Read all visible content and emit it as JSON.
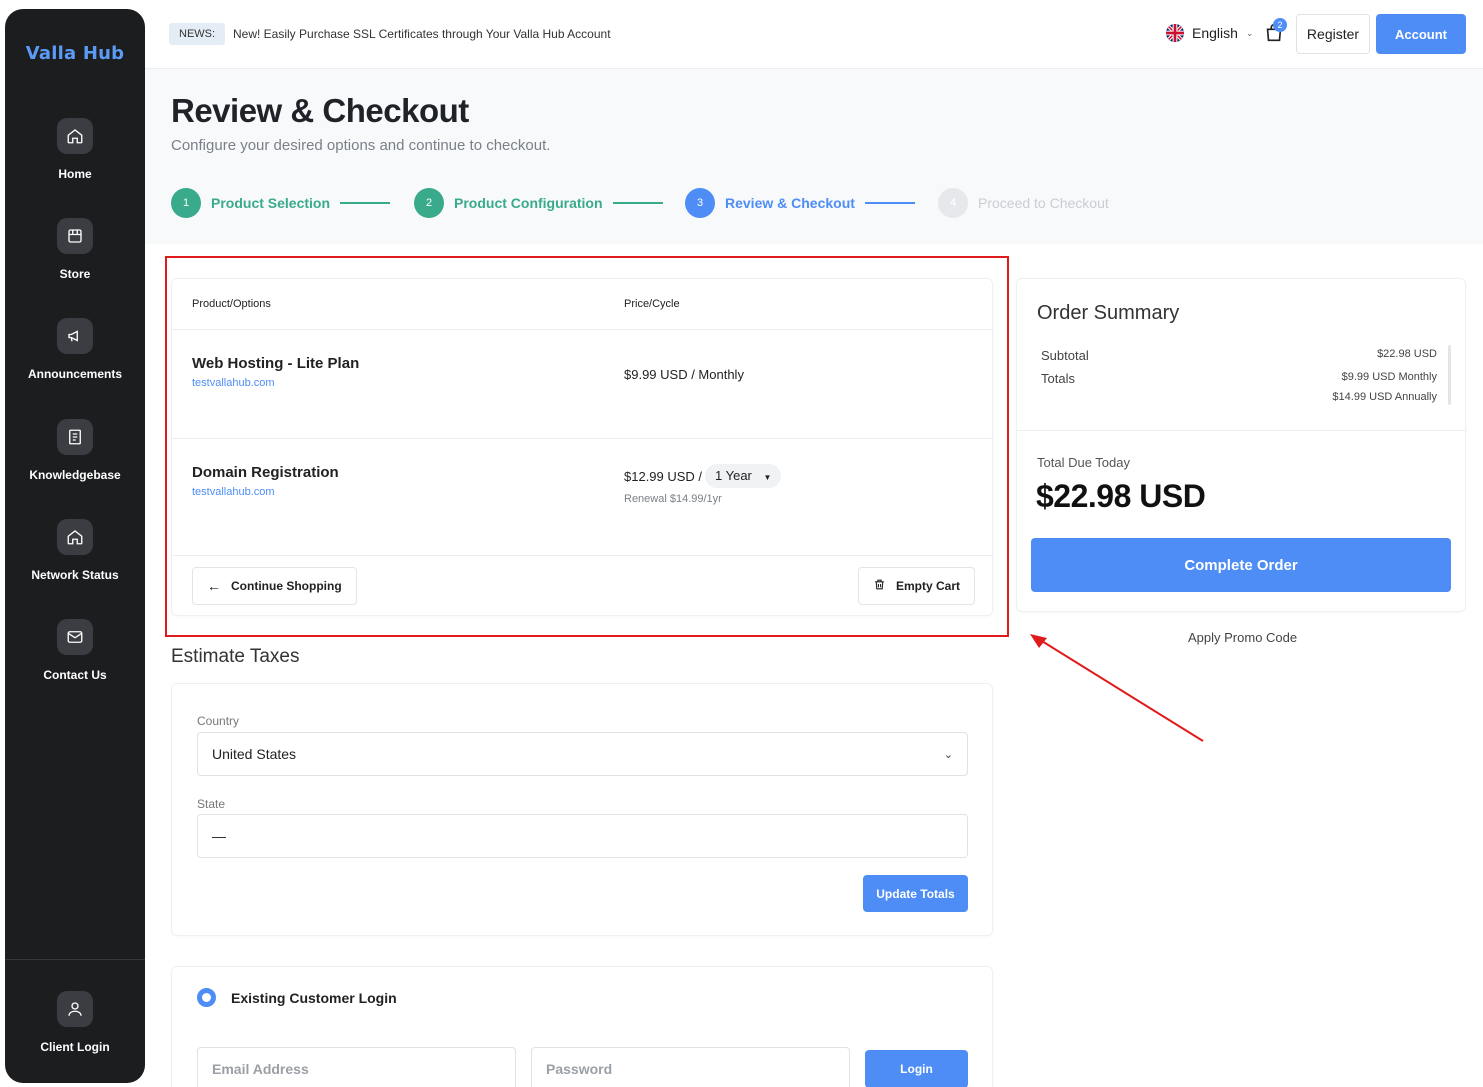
{
  "brand": "Valla Hub",
  "sidebar": {
    "items": [
      {
        "label": "Home",
        "icon": "home-icon"
      },
      {
        "label": "Store",
        "icon": "store-icon"
      },
      {
        "label": "Announcements",
        "icon": "megaphone-icon"
      },
      {
        "label": "Knowledgebase",
        "icon": "book-icon"
      },
      {
        "label": "Network Status",
        "icon": "home-icon"
      },
      {
        "label": "Contact Us",
        "icon": "mail-icon"
      }
    ],
    "footer": {
      "label": "Client Login",
      "icon": "user-icon"
    }
  },
  "topbar": {
    "news_badge": "NEWS:",
    "news_text": "New! Easily Purchase SSL Certificates through Your Valla Hub Account",
    "language": "English",
    "cart_count": "2",
    "register": "Register",
    "account": "Account"
  },
  "header": {
    "title": "Review & Checkout",
    "subtitle": "Configure your desired options and continue to checkout."
  },
  "steps": [
    {
      "num": "1",
      "label": "Product Selection",
      "state": "done"
    },
    {
      "num": "2",
      "label": "Product Configuration",
      "state": "done"
    },
    {
      "num": "3",
      "label": "Review & Checkout",
      "state": "active"
    },
    {
      "num": "4",
      "label": "Proceed to Checkout",
      "state": "pending"
    }
  ],
  "cart": {
    "col_product": "Product/Options",
    "col_price": "Price/Cycle",
    "items": [
      {
        "name": "Web Hosting - Lite Plan",
        "domain": "testvallahub.com",
        "price": "$9.99 USD / Monthly"
      },
      {
        "name": "Domain Registration",
        "domain": "testvallahub.com",
        "price": "$12.99 USD /",
        "cycle": "1 Year",
        "renewal": "Renewal $14.99/1yr"
      }
    ],
    "continue_shopping": "Continue Shopping",
    "empty_cart": "Empty Cart"
  },
  "summary": {
    "title": "Order Summary",
    "subtotal_label": "Subtotal",
    "subtotal_value": "$22.98 USD",
    "totals_label": "Totals",
    "totals_monthly": "$9.99 USD Monthly",
    "totals_annually": "$14.99 USD Annually",
    "due_label": "Total Due Today",
    "due_amount": "$22.98 USD",
    "complete_order": "Complete Order",
    "promo": "Apply Promo Code"
  },
  "taxes": {
    "title": "Estimate Taxes",
    "country_label": "Country",
    "country_value": "United States",
    "state_label": "State",
    "state_value": "—",
    "update_totals": "Update Totals"
  },
  "login": {
    "title": "Existing Customer Login",
    "email_placeholder": "Email Address",
    "password_placeholder": "Password",
    "login_button": "Login"
  },
  "colors": {
    "accent": "#4d8df5",
    "done_step": "#3aaa8c",
    "highlight": "#e01b1b",
    "sidebar_bg": "#1c1d1f"
  }
}
